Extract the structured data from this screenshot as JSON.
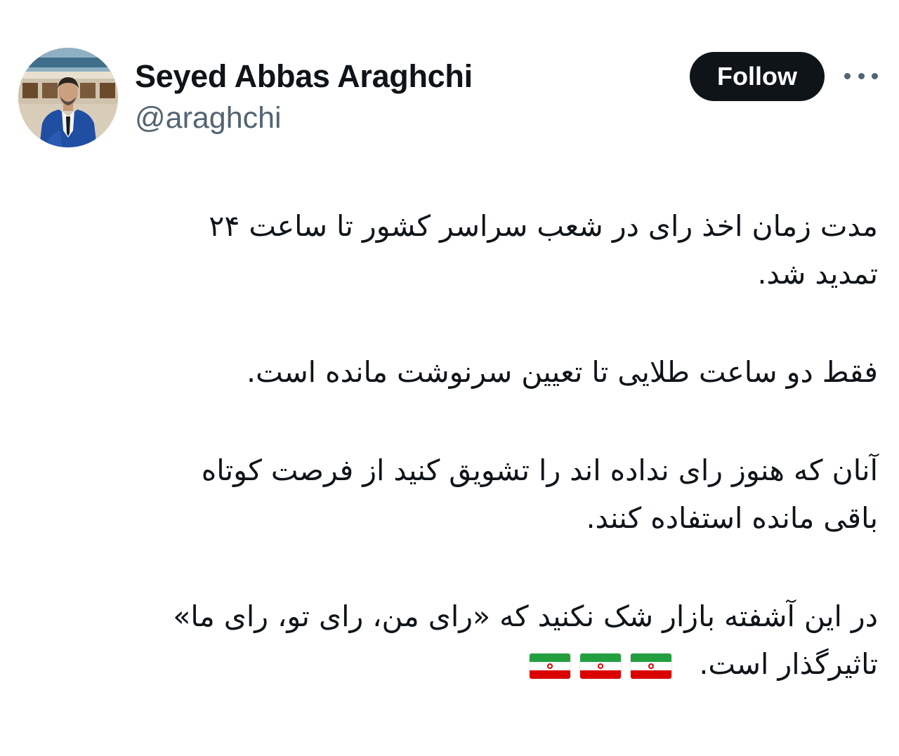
{
  "author": {
    "display_name": "Seyed Abbas Araghchi",
    "handle": "@araghchi",
    "avatar_icon": "profile-photo"
  },
  "actions": {
    "follow_label": "Follow",
    "more_icon": "more-horizontal-icon"
  },
  "tweet": {
    "p1_line1": "مدت زمان اخذ رای در شعب سراسر کشور تا ساعت ۲۴",
    "p1_line2": "تمدید شد.",
    "p2_line1": "فقط دو ساعت طلایی تا تعیین سرنوشت مانده است.",
    "p3_line1": "آنان که هنوز رای نداده اند را تشویق کنید از فرصت کوتاه",
    "p3_line2": "باقی مانده استفاده کنند.",
    "p4_line1": "در این آشفته بازار شک نکنید که «رای من، رای تو، رای ما»",
    "p4_line2": "تاثیرگذار است.",
    "flags": [
      "iran-flag-emoji",
      "iran-flag-emoji",
      "iran-flag-emoji"
    ]
  },
  "colors": {
    "text": "#0f1419",
    "secondary": "#536471",
    "button_bg": "#0f1419",
    "button_text": "#ffffff",
    "background": "#ffffff"
  }
}
